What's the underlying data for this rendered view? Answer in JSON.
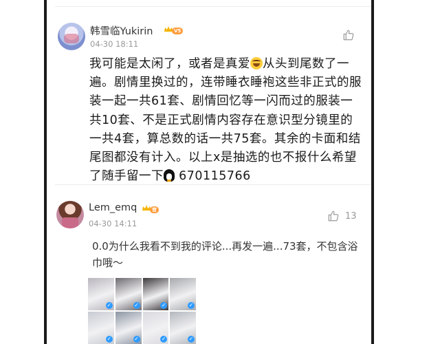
{
  "comments": [
    {
      "username": "韩雪临Yukirin",
      "level_badge": "V5",
      "timestamp": "04-30 18:11",
      "body_parts": [
        "我可能是太闲了，或者是真爱",
        "从头到尾数了一遍。剧情里换过的，连带睡衣睡袍这些非正式的服装一起一共61套、剧情回忆等一闪而过的服装一共10套、不是正式剧情内容存在意识型分镜里的一共4套，算总数的话一共75套。其余的卡面和结尾图都没有计入。以上x是抽选的也不报什么希望了随手留一下",
        "670115766"
      ],
      "like_count": ""
    },
    {
      "username": "Lem_emq",
      "level_badge": "官",
      "timestamp": "04-30 14:11",
      "body": "0.0为什么我看不到我的评论...再发一遍...73套，不包含浴巾哦～",
      "like_count": "13",
      "images": [
        {
          "check": "✓",
          "color": "#b9b6bd"
        },
        {
          "check": "✓",
          "color": "#6f6b70"
        },
        {
          "check": "✓",
          "color": "#3e3a3d"
        },
        {
          "check": "✓",
          "color": "#a7a9ad"
        },
        {
          "check": "✓",
          "color": "#c8cbd2"
        },
        {
          "check": "✓",
          "color": "#8d96a4"
        },
        {
          "check": "✓",
          "color": "#d9dadf"
        },
        {
          "check": "✓",
          "color": "#b3b7bd"
        }
      ]
    }
  ],
  "colors": {
    "badge_orange": "#ff9d3d",
    "crown_gold": "#f5b400",
    "check_blue": "#2f9bff",
    "meta_gray": "#999999"
  },
  "icons": {
    "like": "thumbs-up-icon",
    "crown": "crown-icon",
    "laugh_emoji": "laughing-emoji-icon",
    "penguin_emoji": "penguin-emoji-icon"
  }
}
